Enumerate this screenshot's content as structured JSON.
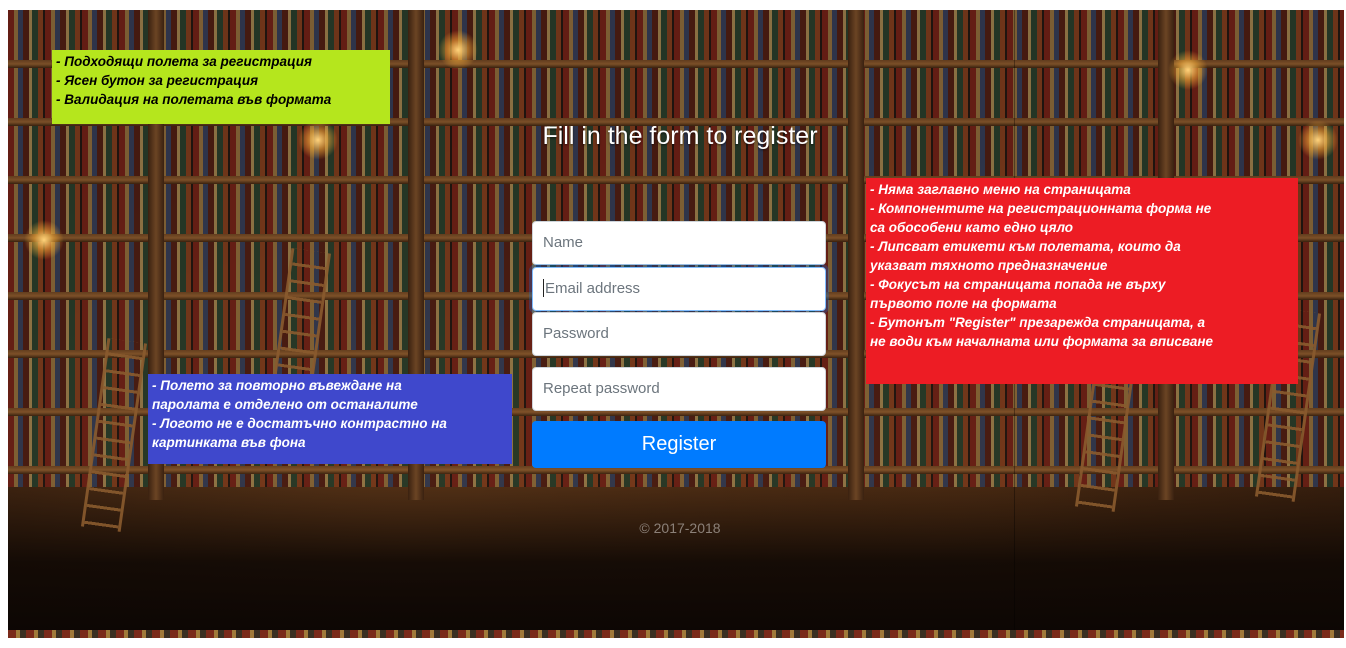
{
  "form": {
    "title": "Fill in the form to register",
    "fields": [
      {
        "name": "name",
        "placeholder": "Name"
      },
      {
        "name": "email",
        "placeholder": "Email address"
      },
      {
        "name": "password",
        "placeholder": "Password"
      },
      {
        "name": "repeat-password",
        "placeholder": "Repeat password"
      }
    ],
    "submit_label": "Register",
    "footer": "© 2017-2018"
  },
  "notes": {
    "green": [
      "- Подходящи полета за регистрация",
      "- Ясен бутон за регистрация",
      "- Валидация на полетата във формата"
    ],
    "blue": [
      " - Полето за повторно въвеждане на",
      "паролата е отделено от останалите",
      " - Логото не е достатъчно контрастно на",
      "картинката във фона"
    ],
    "red": [
      " - Няма заглавно меню на страницата",
      " - Компонентите на регистрационната форма не",
      "са обособени като едно цяло",
      " - Липсват етикети към полетата, които да",
      "указват тяхното предназначение",
      " - Фокусът на страницата попада не върху",
      "първото поле на формата",
      " - Бутонът \"Register\" презарежда страницата, а",
      "не води към началната или формата за вписване"
    ]
  },
  "colors": {
    "button": "#007bff",
    "note_green": "#b5e61d",
    "note_blue": "#3f48cc",
    "note_red": "#ed1c24"
  }
}
